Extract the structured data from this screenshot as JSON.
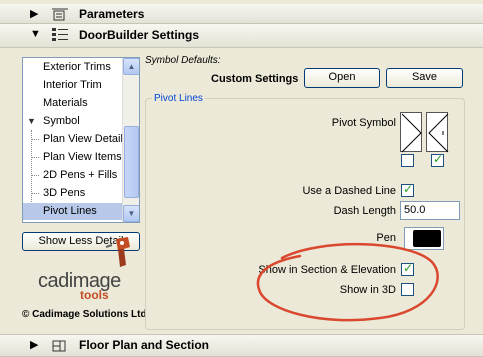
{
  "sections": {
    "parameters": "Parameters",
    "doorbuilder": "DoorBuilder Settings",
    "floorplan": "Floor Plan and Section"
  },
  "list": {
    "items": [
      {
        "label": "Exterior Trims",
        "selected": false
      },
      {
        "label": "Interior Trim",
        "selected": false
      },
      {
        "label": "Materials",
        "selected": false
      },
      {
        "label": "Symbol",
        "selected": false,
        "expanded": true
      },
      {
        "label": "Plan View Detail",
        "selected": false
      },
      {
        "label": "Plan View Items",
        "selected": false
      },
      {
        "label": "2D Pens + Fills",
        "selected": false
      },
      {
        "label": "3D Pens",
        "selected": false
      },
      {
        "label": "Pivot Lines",
        "selected": true
      }
    ]
  },
  "left_buttons": {
    "show_less": "Show Less Detail"
  },
  "logo": {
    "brand": "cadimage",
    "sub": "tools",
    "copyright": "© Cadimage Solutions Ltd"
  },
  "symbol_defaults": {
    "label": "Symbol Defaults:",
    "value": "Custom Settings",
    "open": "Open",
    "save": "Save"
  },
  "pivot": {
    "group_title": "Pivot Lines",
    "pivot_symbol_label": "Pivot Symbol",
    "pivot_left_checked": false,
    "pivot_right_checked": true,
    "dashed_label": "Use a Dashed Line",
    "dashed_checked": true,
    "dash_length_label": "Dash Length",
    "dash_length_value": "50.0",
    "pen_label": "Pen",
    "pen_color": "#000000",
    "show_section_label": "Show in Section & Elevation",
    "show_section_checked": true,
    "show_3d_label": "Show in 3D",
    "show_3d_checked": false
  },
  "colors": {
    "annotation": "#d9482f",
    "selection": "#b7c8e8",
    "accent": "#0046d5"
  }
}
